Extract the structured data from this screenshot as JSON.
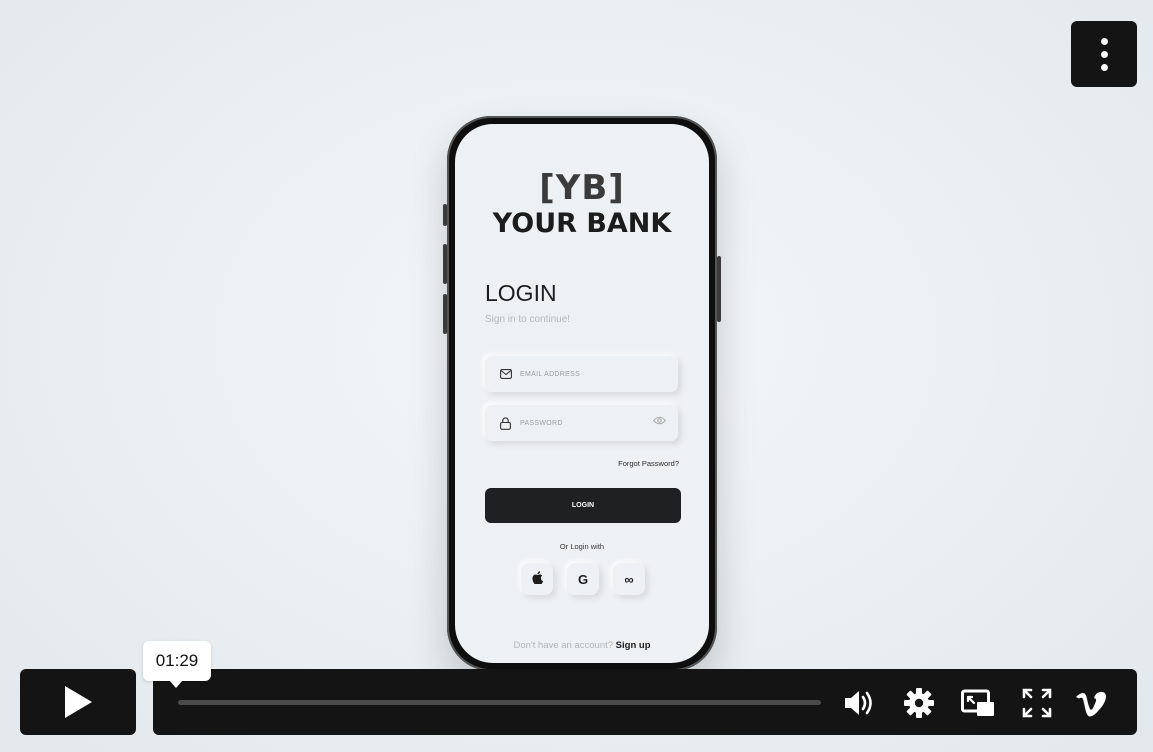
{
  "player": {
    "current_time": "01:29",
    "progress_fraction": 0.0,
    "controls": {
      "play_icon": "play-icon",
      "menu_icon": "more-vertical-icon",
      "volume_icon": "volume-icon",
      "settings_icon": "gear-icon",
      "pip_icon": "picture-in-picture-icon",
      "fullscreen_icon": "fullscreen-icon",
      "brand_icon": "vimeo-logo-icon"
    }
  },
  "app": {
    "logo_mark": "[YB]",
    "logo_name": "YOUR BANK",
    "title": "LOGIN",
    "subtitle": "Sign in to continue!",
    "email_placeholder": "EMAIL ADDRESS",
    "password_placeholder": "PASSWORD",
    "forgot": "Forgot Password?",
    "login_button": "LOGIN",
    "or_text": "Or Login with",
    "social": [
      {
        "icon": "apple-icon",
        "glyph": ""
      },
      {
        "icon": "google-icon",
        "glyph": "G"
      },
      {
        "icon": "meta-icon",
        "glyph": "∞"
      }
    ],
    "signup_prompt": "Don't have an account?",
    "signup_link": "Sign up"
  },
  "colors": {
    "control_bg": "#141414",
    "screen_bg": "#eef1f3",
    "button_dark": "#1f2021"
  }
}
